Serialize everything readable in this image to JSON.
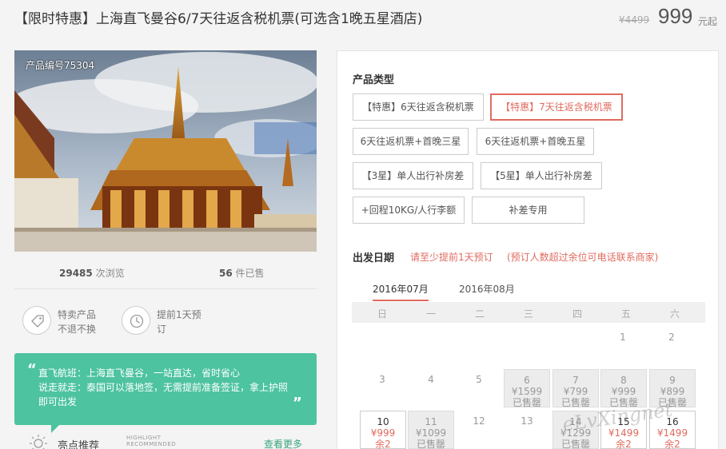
{
  "header": {
    "title": "【限时特惠】上海直飞曼谷6/7天往返含税机票(可选含1晚五星酒店)",
    "old_price": "¥4499",
    "price": "999",
    "price_unit": "元起"
  },
  "left": {
    "product_code": "产品编号75304",
    "views_count": "29485",
    "views_label": " 次浏览",
    "sold_count": "56",
    "sold_label": " 件已售",
    "features": [
      {
        "icon": "tag-icon",
        "line1": "特卖产品",
        "line2": "不退不换"
      },
      {
        "icon": "clock-icon",
        "line1": "提前1天预",
        "line2": "订"
      }
    ],
    "notice_lines": [
      "直飞航班：上海直飞曼谷，一站直达，省时省心",
      "说走就走：泰国可以落地签，无需提前准备签证，拿上护照",
      "即可出发"
    ],
    "highlight_label": "亮点推荐",
    "highlight_en1": "HIGHLIGHT",
    "highlight_en2": "RECOMMENDED",
    "see_more": "查看更多"
  },
  "panel": {
    "type_title": "产品类型",
    "options": [
      "【特惠】6天往返含税机票",
      "【特惠】7天往返含税机票",
      "6天往返机票+首晚三星",
      "6天往返机票+首晚五星",
      "【3星】单人出行补房差",
      "【5星】单人出行补房差",
      "+回程10KG/人行李额",
      "补差专用"
    ],
    "selected_option": 1,
    "date_title": "出发日期",
    "date_note1": "请至少提前1天预订",
    "date_note2": "(预订人数超过余位可电话联系商家)",
    "months": [
      "2016年07月",
      "2016年08月"
    ],
    "weekdays": [
      "日",
      "一",
      "二",
      "三",
      "四",
      "五",
      "六"
    ],
    "days": [
      {
        "n": "1"
      },
      {
        "n": "2"
      },
      {
        "n": "3"
      },
      {
        "n": "4"
      },
      {
        "n": "5"
      },
      {
        "n": "6",
        "p": "¥1599",
        "r": "已售罄"
      },
      {
        "n": "7",
        "p": "¥799",
        "r": "已售罄"
      },
      {
        "n": "8",
        "p": "¥999",
        "r": "已售罄"
      },
      {
        "n": "9",
        "p": "¥899",
        "r": "已售罄"
      },
      {
        "n": "10",
        "p": "¥999",
        "r": "余2"
      },
      {
        "n": "11",
        "p": "¥1099",
        "r": "已售罄"
      },
      {
        "n": "12"
      },
      {
        "n": "13"
      },
      {
        "n": "14",
        "p": "¥1299",
        "r": "已售罄"
      },
      {
        "n": "15",
        "p": "¥1499",
        "r": "余2"
      },
      {
        "n": "16",
        "p": "¥1499",
        "r": "余2"
      }
    ]
  },
  "watermark": "eLvXingnet"
}
